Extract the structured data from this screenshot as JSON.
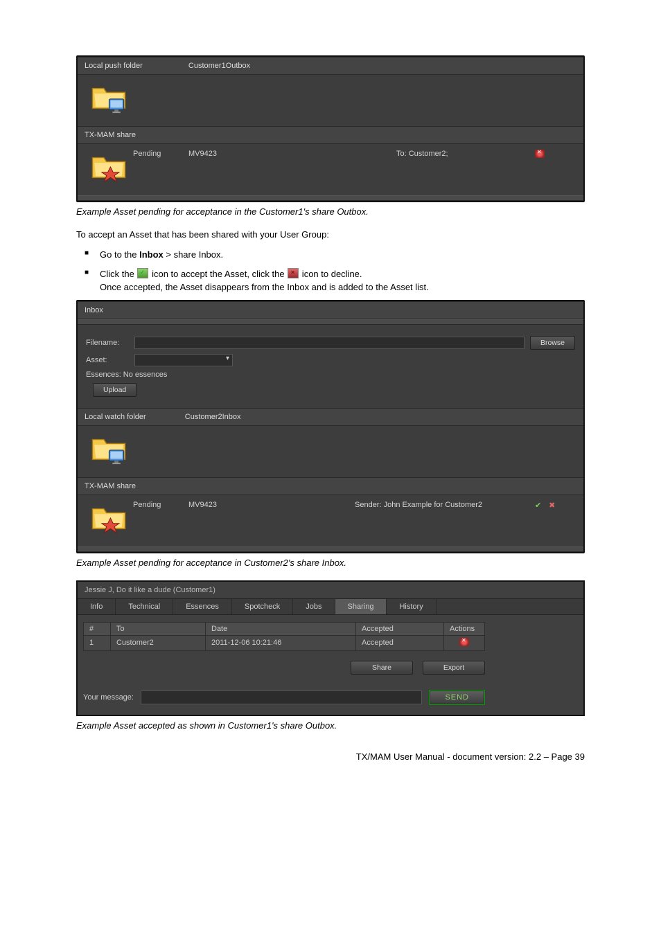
{
  "outbox_panel": {
    "local_push_label": "Local push folder",
    "local_push_value": "Customer1Outbox",
    "txmam_label": "TX-MAM share",
    "status": "Pending",
    "asset_id": "MV9423",
    "to_label": "To: Customer2;"
  },
  "caption1": "Example Asset pending for acceptance in the Customer1's share Outbox.",
  "body_intro": "To accept an Asset that has been shared with your User Group:",
  "bullet1_pre": "Go to the ",
  "bullet1_bold": "Inbox",
  "bullet1_post": " > share Inbox.",
  "bullet2_pre": "Click the ",
  "bullet2_mid": " icon to accept the Asset, click the ",
  "bullet2_post": " icon to decline.",
  "bullet2_line2": "Once accepted, the Asset disappears from the Inbox and is added to the Asset list.",
  "inbox_panel": {
    "title": "Inbox",
    "filename_label": "Filename:",
    "browse_btn": "Browse",
    "asset_label": "Asset:",
    "essences_label": "Essences: No essences",
    "upload_btn": "Upload",
    "local_watch_label": "Local watch folder",
    "local_watch_value": "Customer2Inbox",
    "txmam_label": "TX-MAM share",
    "status": "Pending",
    "asset_id": "MV9423",
    "sender_label": "Sender: John Example for Customer2"
  },
  "caption2": "Example Asset pending for acceptance in Customer2's share Inbox.",
  "sharing_panel": {
    "title": "Jessie J, Do it like a dude (Customer1)",
    "tabs": [
      "Info",
      "Technical",
      "Essences",
      "Spotcheck",
      "Jobs",
      "Sharing",
      "History"
    ],
    "active_tab": 5,
    "cols": {
      "num": "#",
      "to": "To",
      "date": "Date",
      "accepted": "Accepted",
      "actions": "Actions"
    },
    "row": {
      "num": "1",
      "to": "Customer2",
      "date": "2011-12-06 10:21:46",
      "accepted": "Accepted"
    },
    "share_btn": "Share",
    "export_btn": "Export",
    "msg_label": "Your message:",
    "send_btn": "SEND"
  },
  "caption3": "Example Asset accepted as shown in Customer1's share Outbox.",
  "footer": "TX/MAM User Manual - document version: 2.2 – Page 39"
}
